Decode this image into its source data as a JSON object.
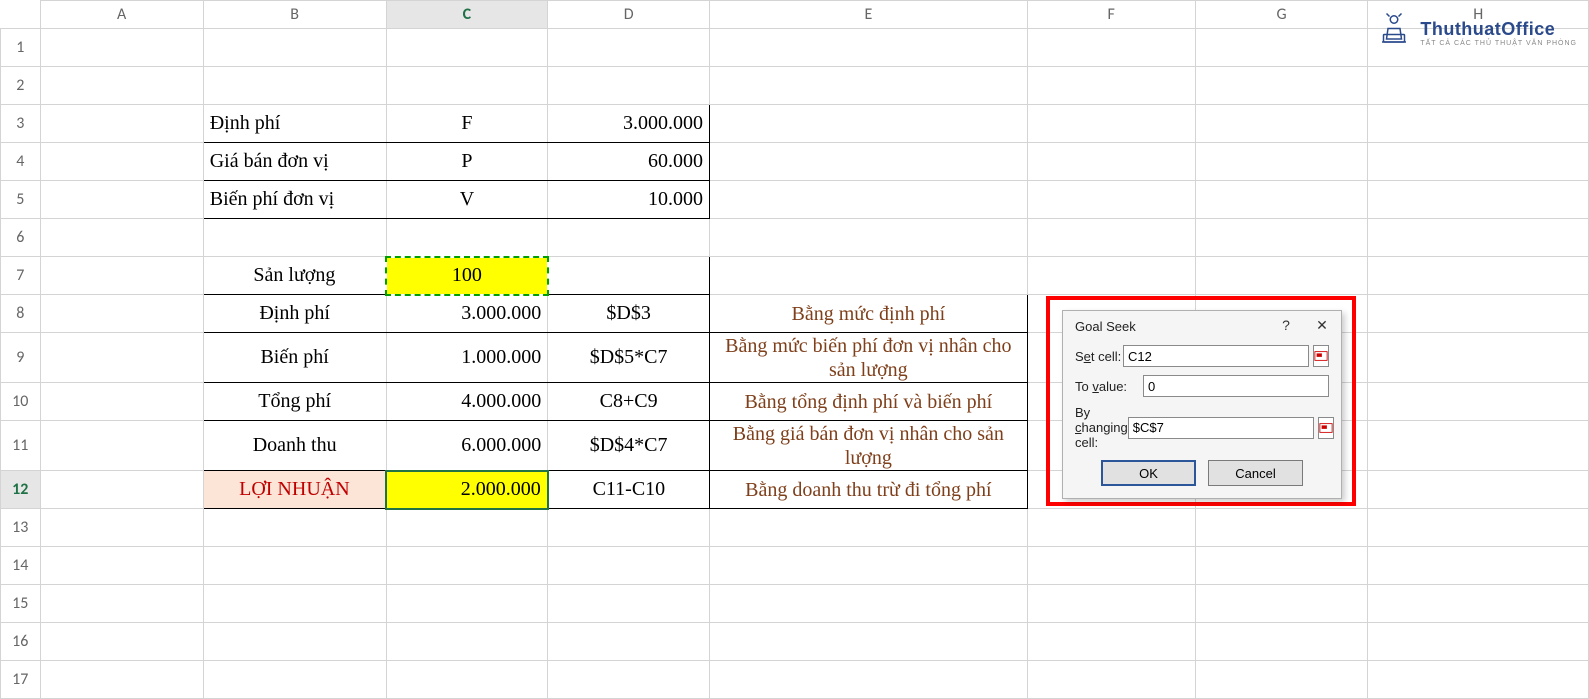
{
  "columns": [
    "A",
    "B",
    "C",
    "D",
    "E",
    "F",
    "G",
    "H"
  ],
  "rows": [
    "1",
    "2",
    "3",
    "4",
    "5",
    "6",
    "7",
    "8",
    "9",
    "10",
    "11",
    "12",
    "13",
    "14",
    "15",
    "16",
    "17"
  ],
  "active_column": "C",
  "selected_row": "12",
  "params": {
    "r3": {
      "label": "Định phí",
      "sym": "F",
      "val": "3.000.000"
    },
    "r4": {
      "label": "Giá bán đơn vị",
      "sym": "P",
      "val": "60.000"
    },
    "r5": {
      "label": "Biến phí đơn vị",
      "sym": "V",
      "val": "10.000"
    }
  },
  "section": {
    "r7": {
      "label": "Sản lượng",
      "value": "100"
    },
    "r8": {
      "label": "Định phí",
      "value": "3.000.000",
      "formula": "$D$3",
      "note": "Bằng mức định phí"
    },
    "r9": {
      "label": "Biến phí",
      "value": "1.000.000",
      "formula": "$D$5*C7",
      "note": "Bằng mức biến phí đơn vị nhân cho sản lượng"
    },
    "r10": {
      "label": "Tổng phí",
      "value": "4.000.000",
      "formula": "C8+C9",
      "note": "Bằng tổng định phí và biến phí"
    },
    "r11": {
      "label": "Doanh thu",
      "value": "6.000.000",
      "formula": "$D$4*C7",
      "note": "Bằng giá bán đơn vị nhân cho sản lượng"
    },
    "r12": {
      "label": "LỢI NHUẬN",
      "value": "2.000.000",
      "formula": "C11-C10",
      "note": "Bằng doanh thu trừ đi tổng phí"
    }
  },
  "dialog": {
    "title": "Goal Seek",
    "set_cell_label": "Set cell:",
    "set_cell_value": "C12",
    "to_value_label": "To value:",
    "to_value_value": "0",
    "by_changing_label": "By changing cell:",
    "by_changing_value": "$C$7",
    "ok": "OK",
    "cancel": "Cancel",
    "help": "?",
    "close": "✕"
  },
  "watermark": {
    "main": "ThuthuatOffice",
    "sub": "TẤT CẢ CÁC THỦ THUẬT VĂN PHÒNG"
  }
}
